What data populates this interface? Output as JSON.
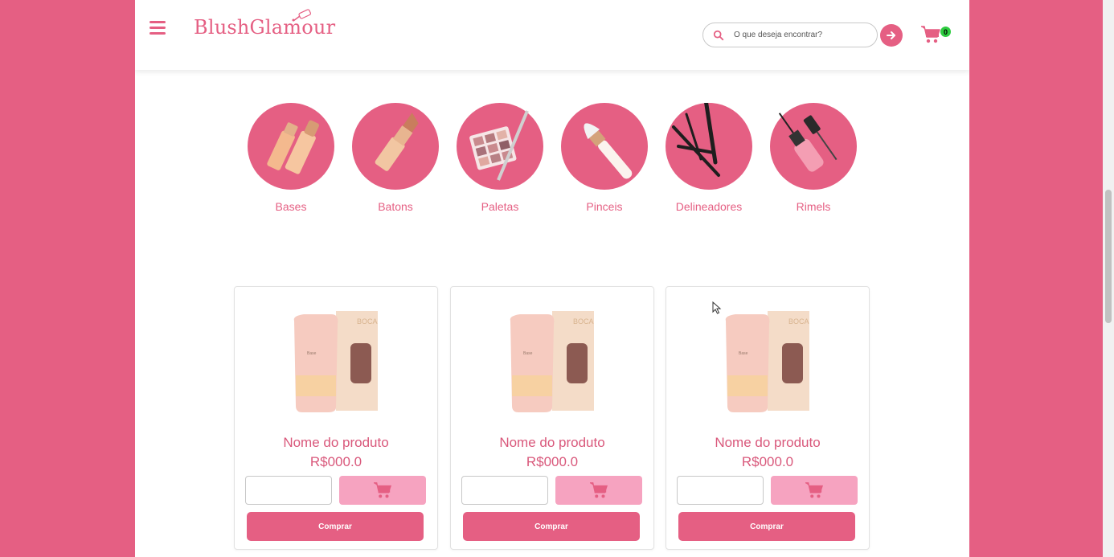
{
  "header": {
    "logo_text": "BlushGlamour",
    "search_placeholder": "O que deseja encontrar?",
    "cart_count": "0"
  },
  "categories": [
    {
      "label": "Bases"
    },
    {
      "label": "Batons"
    },
    {
      "label": "Paletas"
    },
    {
      "label": "Pinceis"
    },
    {
      "label": "Delineadores"
    },
    {
      "label": "Rimels"
    }
  ],
  "products": [
    {
      "name": "Nome do produto",
      "price": "R$000.0",
      "buy_label": "Comprar"
    },
    {
      "name": "Nome do produto",
      "price": "R$000.0",
      "buy_label": "Comprar"
    },
    {
      "name": "Nome do produto",
      "price": "R$000.0",
      "buy_label": "Comprar"
    }
  ],
  "colors": {
    "brand": "#e55f83",
    "add_to_cart": "#f6a3c0",
    "badge": "#2ecc40"
  },
  "icons": {
    "menu": "hamburger-menu-icon",
    "search": "search-icon",
    "go": "arrow-right-icon",
    "cart": "shopping-cart-icon"
  }
}
